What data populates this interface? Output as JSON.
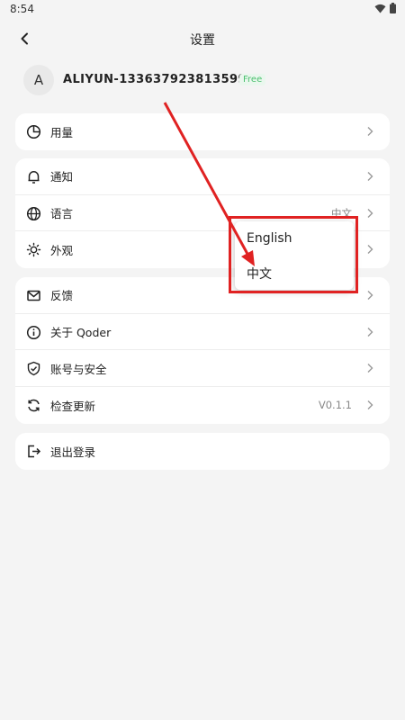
{
  "status_bar": {
    "time": "8:54"
  },
  "header": {
    "title": "设置"
  },
  "profile": {
    "avatar_letter": "A",
    "username": "ALIYUN-1336379238135992",
    "plan": "Free"
  },
  "groups": [
    {
      "rows": [
        {
          "label": "用量",
          "value": ""
        }
      ]
    },
    {
      "rows": [
        {
          "label": "通知",
          "value": ""
        },
        {
          "label": "语言",
          "value": "中文"
        },
        {
          "label": "外观",
          "value": ""
        }
      ]
    },
    {
      "rows": [
        {
          "label": "反馈",
          "value": ""
        },
        {
          "label": "关于 Qoder",
          "value": ""
        },
        {
          "label": "账号与安全",
          "value": ""
        },
        {
          "label": "检查更新",
          "value": "V0.1.1"
        }
      ]
    },
    {
      "rows": [
        {
          "label": "退出登录",
          "value": ""
        }
      ]
    }
  ],
  "language_menu": {
    "options": [
      "English",
      "中文"
    ]
  },
  "colors": {
    "annotation": "#e02222",
    "plan_badge": "#4cc06f"
  }
}
